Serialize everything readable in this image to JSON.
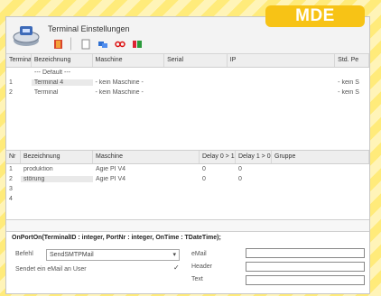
{
  "badge": "MDE",
  "window": {
    "title": "Terminal Einstellungen",
    "toolbar": {
      "icons": [
        "book-icon",
        "new-document-icon",
        "computers-icon",
        "glasses-icon",
        "link-icon"
      ]
    }
  },
  "terminals": {
    "columns": [
      "TerminalID",
      "Bezeichnung",
      "Maschine",
      "Serial",
      "IP",
      "Std. Pe"
    ],
    "default_label": "--- Default ---",
    "rows": [
      {
        "id": "1",
        "name": "Terminal 4",
        "machine": "- kein Maschine -",
        "serial": "",
        "ip": "",
        "std": "- kein S"
      },
      {
        "id": "2",
        "name": "Terminal",
        "machine": "- kein Maschine -",
        "serial": "",
        "ip": "",
        "std": "- kein S"
      }
    ]
  },
  "ports": {
    "columns": [
      "Nr",
      "Bezeichnung",
      "Maschine",
      "Delay 0 > 1",
      "Delay 1 > 0",
      "Gruppe"
    ],
    "rows": [
      {
        "nr": "1",
        "name": "produktion",
        "machine": "Agie PI V4",
        "d01": "0",
        "d10": "0",
        "group": ""
      },
      {
        "nr": "2",
        "name": "störung",
        "machine": "Agie PI V4",
        "d01": "0",
        "d10": "0",
        "group": ""
      },
      {
        "nr": "3",
        "name": "",
        "machine": "",
        "d01": "",
        "d10": "",
        "group": ""
      },
      {
        "nr": "4",
        "name": "",
        "machine": "",
        "d01": "",
        "d10": "",
        "group": ""
      }
    ]
  },
  "function_signature": "OnPortOn(TerminalID : integer, PortNr : integer, OnTime : TDateTime);",
  "form": {
    "befehl_label": "Befehl",
    "befehl_value": "SendSMTPMail",
    "sendet_label": "Sendet ein eMail an User",
    "email_label": "eMail",
    "header_label": "Header",
    "extra_label": "Text"
  }
}
